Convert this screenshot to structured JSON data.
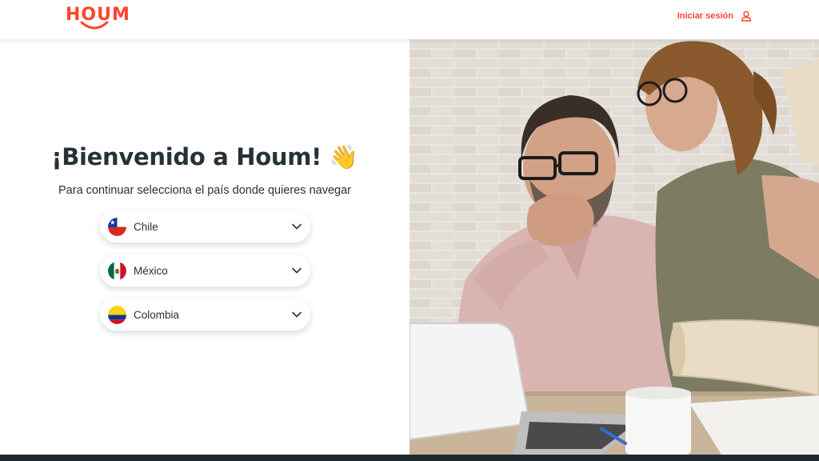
{
  "header": {
    "logo_text": "HOUM",
    "login_label": "Iniciar sesión"
  },
  "welcome": {
    "title": "¡Bienvenido a Houm! 👋",
    "subtitle": "Para continuar selecciona el país donde quieres navegar"
  },
  "countries": [
    {
      "label": "Chile",
      "flag": "chile-flag-icon"
    },
    {
      "label": "México",
      "flag": "mexico-flag-icon"
    },
    {
      "label": "Colombia",
      "flag": "colombia-flag-icon"
    }
  ],
  "colors": {
    "brand": "#ff452b",
    "text": "#263238",
    "footer": "#1f2a30"
  }
}
